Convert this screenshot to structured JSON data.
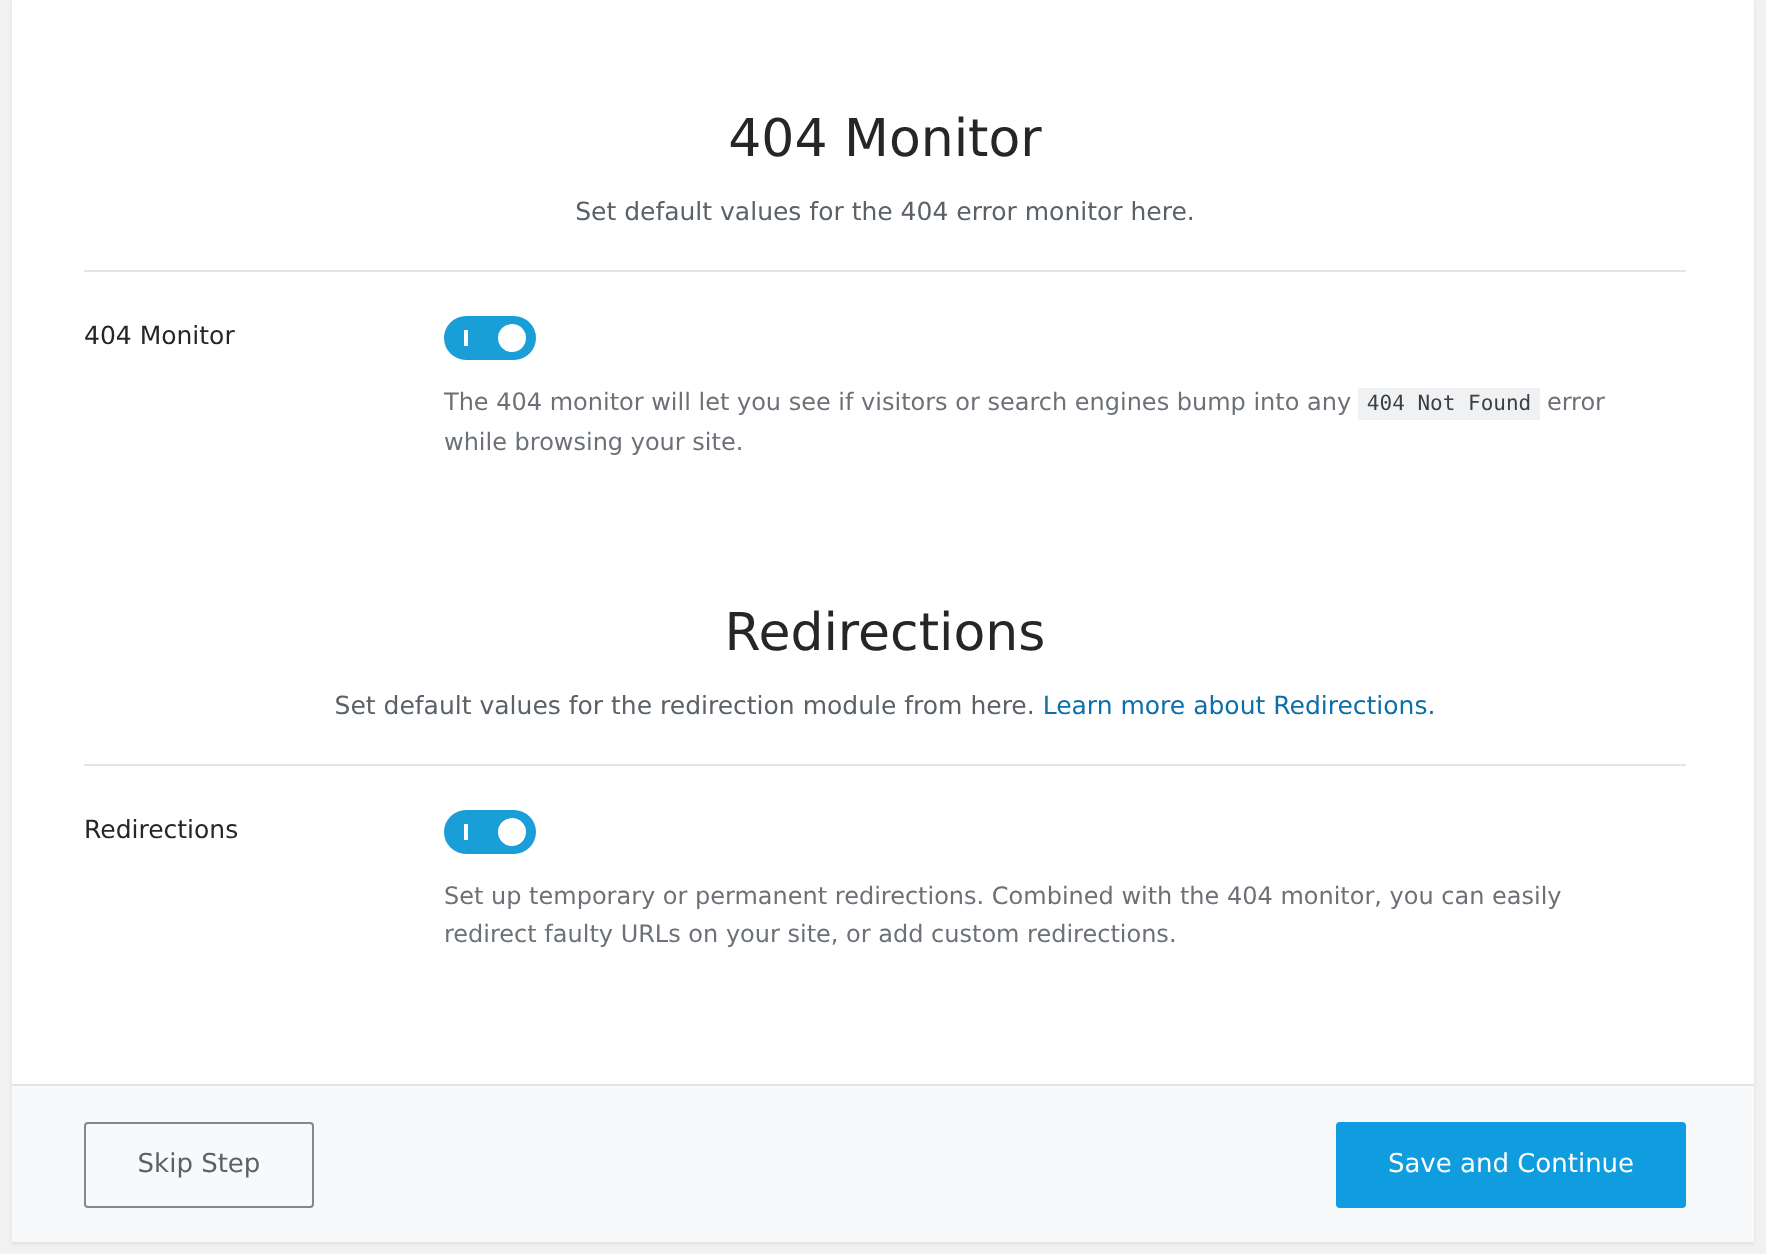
{
  "sections": [
    {
      "title": "404 Monitor",
      "subtitle": "Set default values for the 404 error monitor here.",
      "setting": {
        "label": "404 Monitor",
        "on": true,
        "description": [
          {
            "kind": "text",
            "text": "The 404 monitor will let you see if visitors or search engines bump into any"
          },
          {
            "kind": "code",
            "text": "404 Not Found"
          },
          {
            "kind": "text",
            "text": "error while browsing your site."
          }
        ]
      }
    },
    {
      "title": "Redirections",
      "subtitle": "Set default values for the redirection module from here.",
      "link": "Learn more about Redirections.",
      "setting": {
        "label": "Redirections",
        "on": true,
        "description": [
          {
            "kind": "text",
            "text": "Set up temporary or permanent redirections. Combined with the 404 monitor, you can easily redirect faulty URLs on your site, or add custom redirections."
          }
        ]
      }
    }
  ],
  "footer": {
    "skip": "Skip Step",
    "save": "Save and Continue"
  }
}
